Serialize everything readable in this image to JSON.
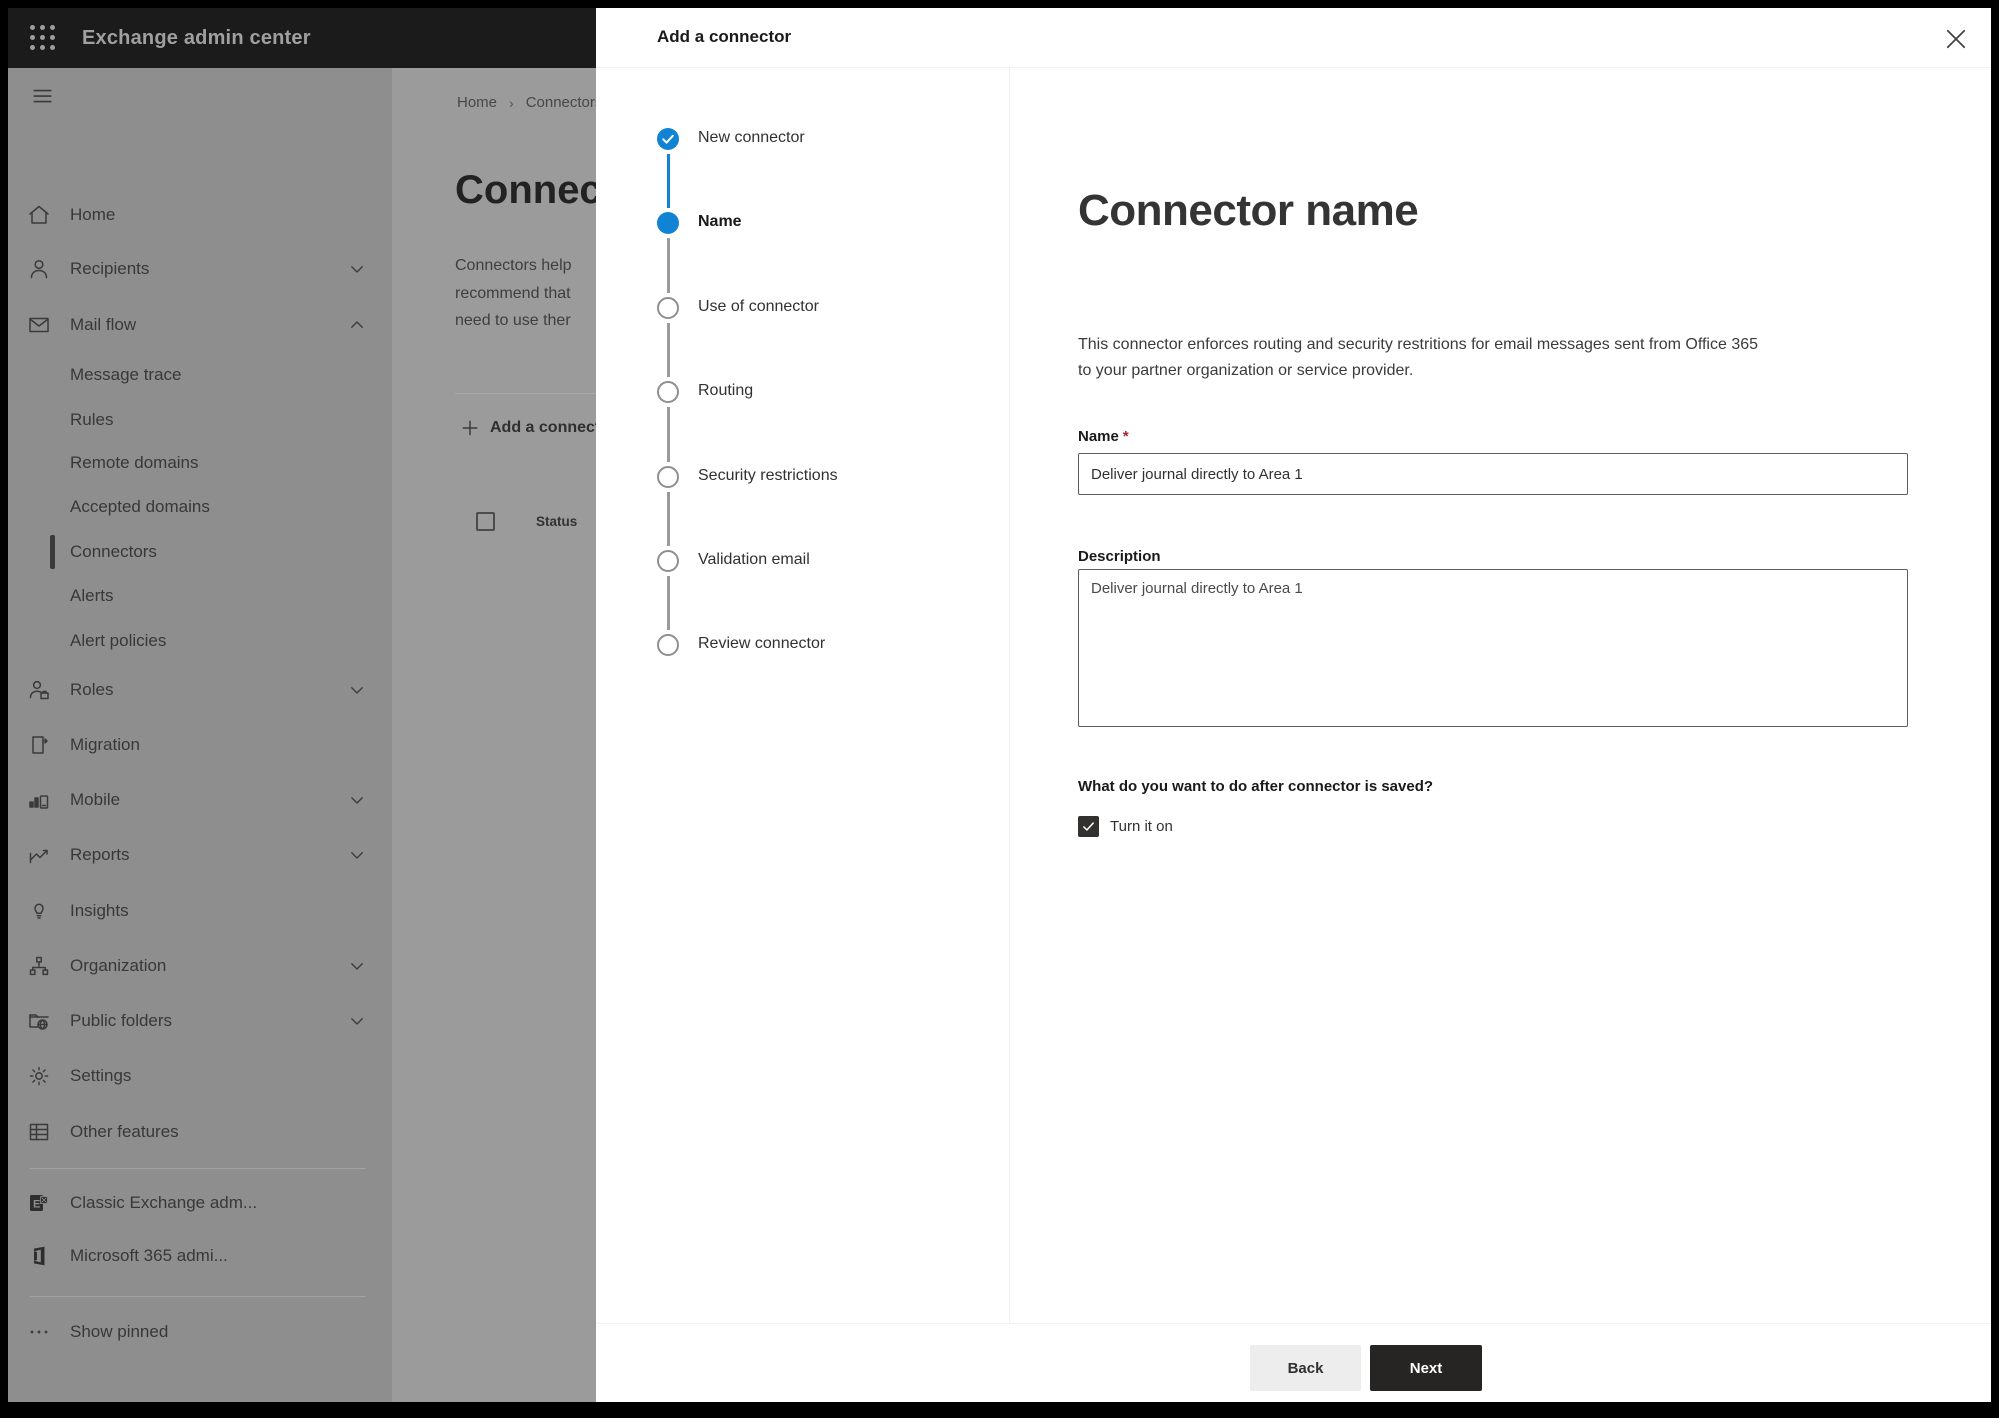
{
  "topbar": {
    "title": "Exchange admin center"
  },
  "sidebar": {
    "items": [
      {
        "label": "Home"
      },
      {
        "label": "Recipients",
        "expandable": true
      },
      {
        "label": "Mail flow",
        "expandable": true,
        "expanded": true
      },
      {
        "label": "Message trace"
      },
      {
        "label": "Rules"
      },
      {
        "label": "Remote domains"
      },
      {
        "label": "Accepted domains"
      },
      {
        "label": "Connectors",
        "selected": true
      },
      {
        "label": "Alerts"
      },
      {
        "label": "Alert policies"
      },
      {
        "label": "Roles",
        "expandable": true
      },
      {
        "label": "Migration"
      },
      {
        "label": "Mobile",
        "expandable": true
      },
      {
        "label": "Reports",
        "expandable": true
      },
      {
        "label": "Insights"
      },
      {
        "label": "Organization",
        "expandable": true
      },
      {
        "label": "Public folders",
        "expandable": true
      },
      {
        "label": "Settings"
      },
      {
        "label": "Other features"
      },
      {
        "label": "Classic Exchange adm..."
      },
      {
        "label": "Microsoft 365 admi..."
      },
      {
        "label": "Show pinned"
      }
    ]
  },
  "page": {
    "breadcrumb": [
      "Home",
      "Connectors"
    ],
    "title": "Connectors",
    "intro_lines": [
      "Connectors help",
      "recommend that",
      "need to use ther"
    ],
    "add_button": "Add a connector",
    "table": {
      "columns": [
        "Status"
      ]
    }
  },
  "dialog": {
    "title": "Add a connector",
    "steps": [
      {
        "label": "New connector",
        "state": "complete"
      },
      {
        "label": "Name",
        "state": "current"
      },
      {
        "label": "Use of connector",
        "state": "upcoming"
      },
      {
        "label": "Routing",
        "state": "upcoming"
      },
      {
        "label": "Security restrictions",
        "state": "upcoming"
      },
      {
        "label": "Validation email",
        "state": "upcoming"
      },
      {
        "label": "Review connector",
        "state": "upcoming"
      }
    ],
    "content": {
      "heading": "Connector name",
      "description_lines": [
        "This connector enforces routing and security restritions for email messages sent from Office 365",
        "to your partner organization or service provider."
      ],
      "name_label": "Name",
      "required_marker": "*",
      "name_value": "Deliver journal directly to Area 1",
      "description_label": "Description",
      "description_value": "Deliver journal directly to Area 1",
      "question": "What do you want to do after connector is saved?",
      "turn_on_label": "Turn it on",
      "turn_on_checked": true
    },
    "footer": {
      "back": "Back",
      "next": "Next"
    }
  },
  "colors": {
    "accent_blue": "#1183d4",
    "next_button": "#262524",
    "required_red": "#a4262c",
    "topbar": "#1b1b1b"
  }
}
